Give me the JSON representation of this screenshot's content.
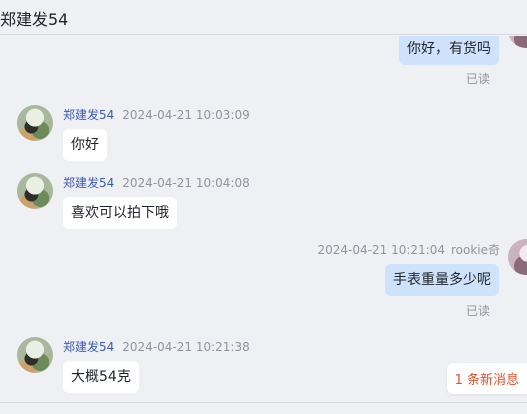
{
  "header": {
    "title": "郑建发54"
  },
  "messages": [
    {
      "direction": "out",
      "text": "你好，有货吗",
      "status": "已读"
    },
    {
      "direction": "in",
      "sender": "郑建发54",
      "time": "2024-04-21 10:03:09",
      "text": "你好"
    },
    {
      "direction": "in",
      "sender": "郑建发54",
      "time": "2024-04-21 10:04:08",
      "text": "喜欢可以拍下哦"
    },
    {
      "direction": "out",
      "sender": "rookie奇",
      "time": "2024-04-21 10:21:04",
      "text": "手表重量多少呢",
      "status": "已读"
    },
    {
      "direction": "in",
      "sender": "郑建发54",
      "time": "2024-04-21 10:21:38",
      "text": "大概54克"
    }
  ],
  "new_messages_label": "1 条新消息"
}
